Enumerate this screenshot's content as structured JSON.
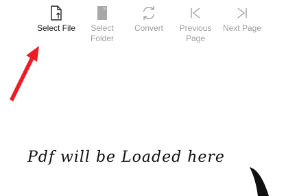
{
  "toolbar": {
    "items": [
      {
        "label": "Select File",
        "icon": "file-icon",
        "enabled": true
      },
      {
        "label": "Select\nFolder",
        "icon": "folder-icon",
        "enabled": false
      },
      {
        "label": "Convert",
        "icon": "refresh-icon",
        "enabled": false
      },
      {
        "label": "Previous\nPage",
        "icon": "previous-page-icon",
        "enabled": false
      },
      {
        "label": "Next Page",
        "icon": "next-page-icon",
        "enabled": false
      }
    ]
  },
  "annotation": {
    "arrow_color": "#ee1c25",
    "placeholder_text": "Pdf will be Loaded here"
  },
  "colors": {
    "enabled_text": "#1f1f1f",
    "disabled_text": "#9e9e9e",
    "background": "#ffffff"
  }
}
